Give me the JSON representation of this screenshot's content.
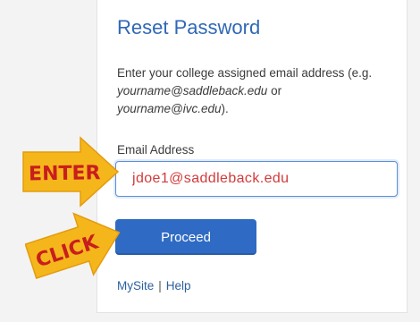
{
  "form": {
    "title": "Reset Password",
    "instructions_prefix": "Enter your college assigned email address (e.g. ",
    "example_1": "yourname@saddleback.edu",
    "instructions_or": " or ",
    "example_2": "yourname@ivc.edu",
    "instructions_suffix": ").",
    "email_label": "Email Address",
    "email_value": "jdoe1@saddleback.edu",
    "proceed_label": "Proceed",
    "link_mysite": "MySite",
    "link_separator": "|",
    "link_help": "Help"
  },
  "annotations": {
    "enter_label": "ENTER",
    "click_label": "CLICK",
    "arrow_color": "#f5b61b",
    "text_color": "#c81e1e"
  },
  "colors": {
    "title": "#2f68b6",
    "button": "#2f6bc4",
    "input_border": "#5b8fd6",
    "input_text": "#d33a3a"
  }
}
